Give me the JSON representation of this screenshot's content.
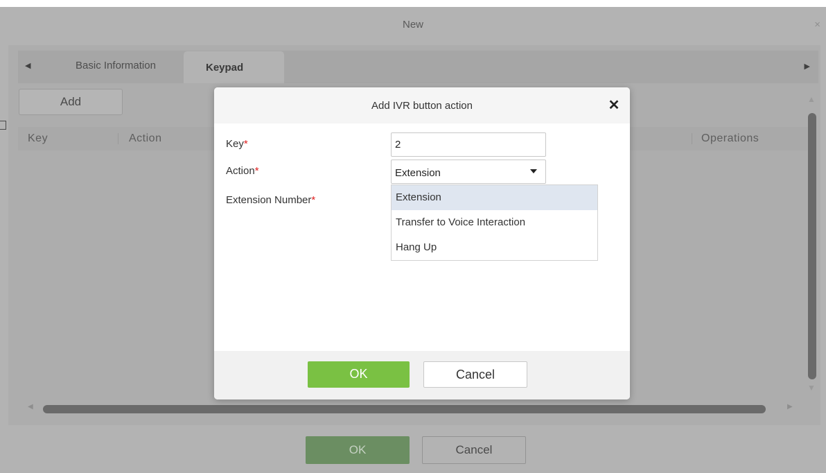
{
  "window": {
    "title": "New",
    "close_glyph": "×",
    "tabs": [
      {
        "label": "Basic Information"
      },
      {
        "label": "Keypad"
      }
    ],
    "tab_prev_glyph": "◀",
    "tab_next_glyph": "▶",
    "add_button_label": "Add",
    "table_columns": [
      "Key",
      "Action",
      "Operations"
    ],
    "ok_label": "OK",
    "cancel_label": "Cancel"
  },
  "dialog": {
    "title": "Add IVR button action",
    "close_glyph": "✕",
    "fields": {
      "key": {
        "label": "Key",
        "value": "2"
      },
      "action": {
        "label": "Action",
        "value": "Extension"
      },
      "extension_number": {
        "label": "Extension Number"
      }
    },
    "required_mark": "*",
    "action_options": [
      "Extension",
      "Transfer to Voice Interaction",
      "Hang Up"
    ],
    "highlighted_option": "Extension",
    "ok_label": "OK",
    "cancel_label": "Cancel"
  },
  "colors": {
    "primary_button": "#7ac143",
    "required_mark": "#e02020",
    "option_highlight": "#dfe6f0"
  },
  "icons": {
    "dialog_close": "close-icon",
    "window_close": "close-icon",
    "select_caret": "caret-down-icon",
    "scroll_arrows": "triangle-arrow-icon"
  }
}
